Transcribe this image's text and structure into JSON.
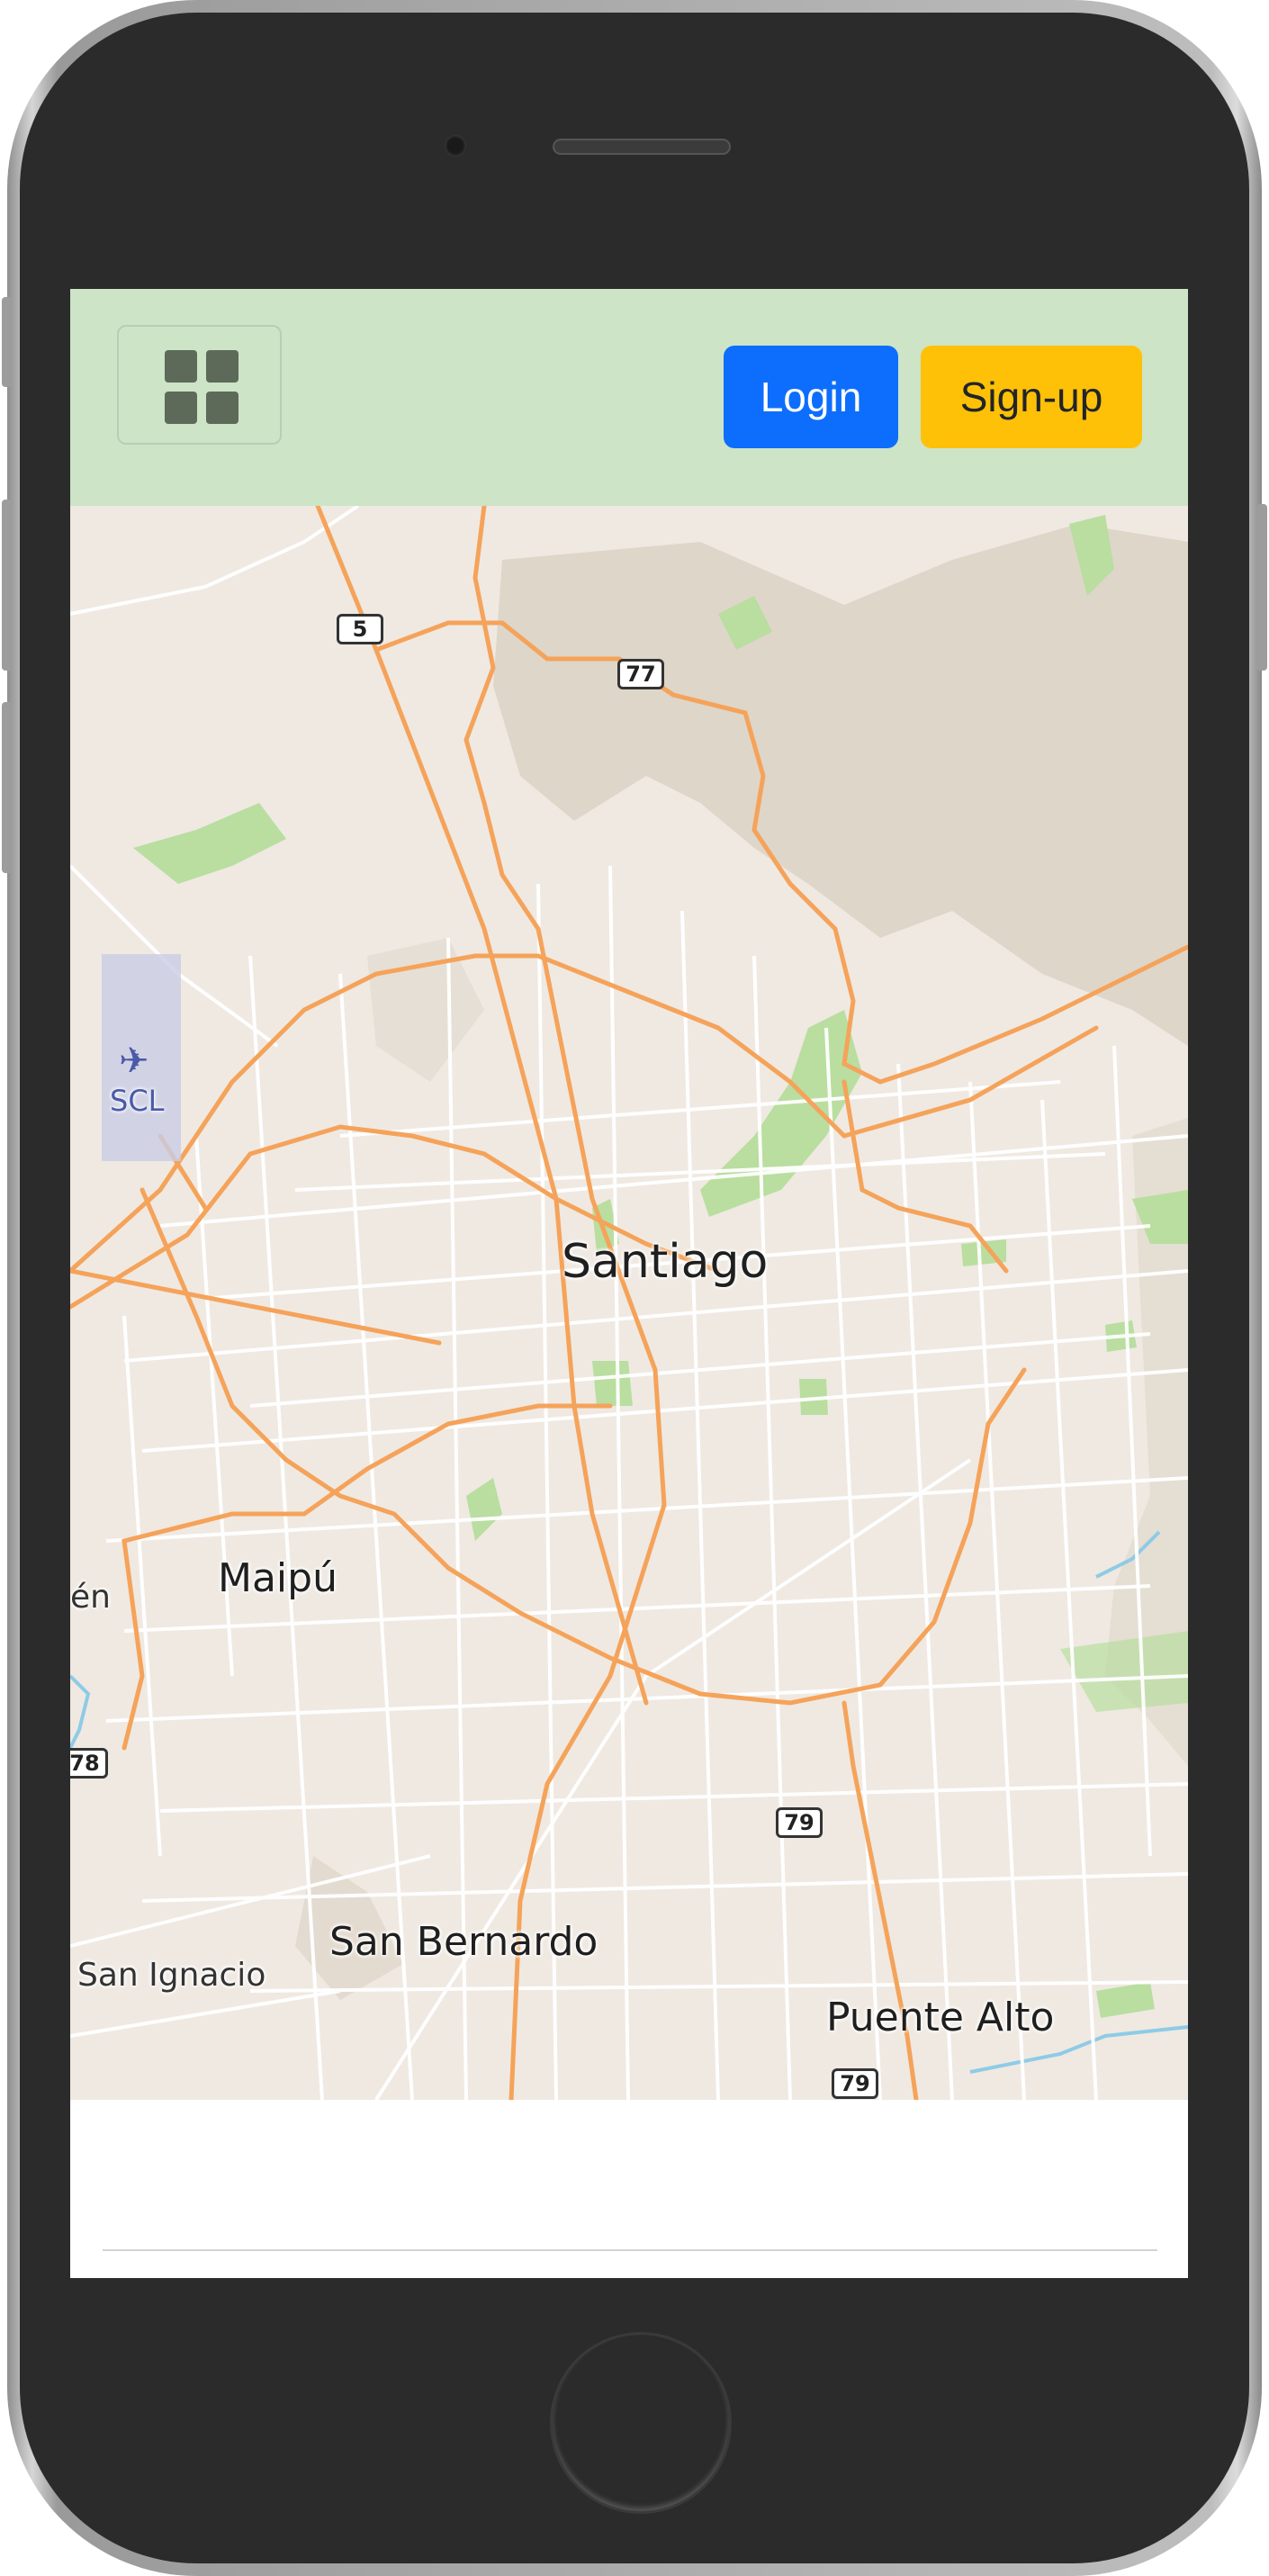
{
  "navbar": {
    "toggle_icon": "grid-icon",
    "login_label": "Login",
    "signup_label": "Sign-up",
    "login_color": "#0d6efd",
    "signup_color": "#ffc107",
    "background_color": "#cde4c7"
  },
  "map": {
    "places": {
      "santiago": "Santiago",
      "maipu": "Maipú",
      "san_bernardo": "San Bernardo",
      "puente_alto": "Puente Alto",
      "san_ignacio": "San Ignacio",
      "partial_left": "én"
    },
    "airport_code": "SCL",
    "airport_icon": "plane-icon",
    "route_shields": {
      "r5": "5",
      "r77": "77",
      "r78": "78",
      "r79_north": "79",
      "r79_south": "79"
    }
  }
}
